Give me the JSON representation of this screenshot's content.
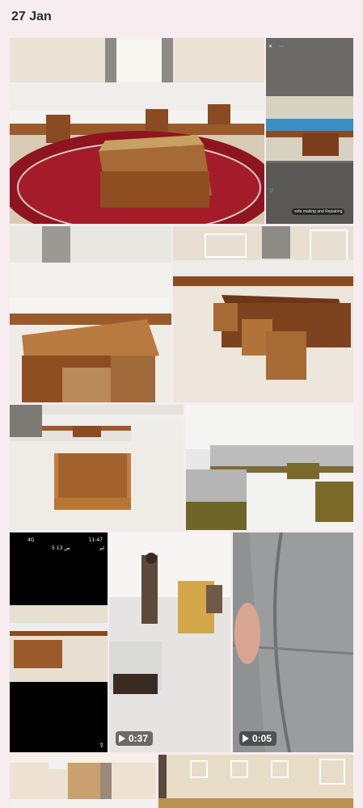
{
  "section": {
    "date": "27 Jan"
  },
  "phone_overlay": {
    "caption": "sofa making and Repairing"
  },
  "phone_status": {
    "time": "11:47",
    "signal": "4G",
    "date": "5 ص 13",
    "carrier": "لم"
  },
  "videos": [
    {
      "duration": "0:37"
    },
    {
      "duration": "0:05"
    }
  ],
  "colors": {
    "accent": "#f7ecef",
    "wood": "#8a4a22",
    "carpet": "#8e1420"
  }
}
